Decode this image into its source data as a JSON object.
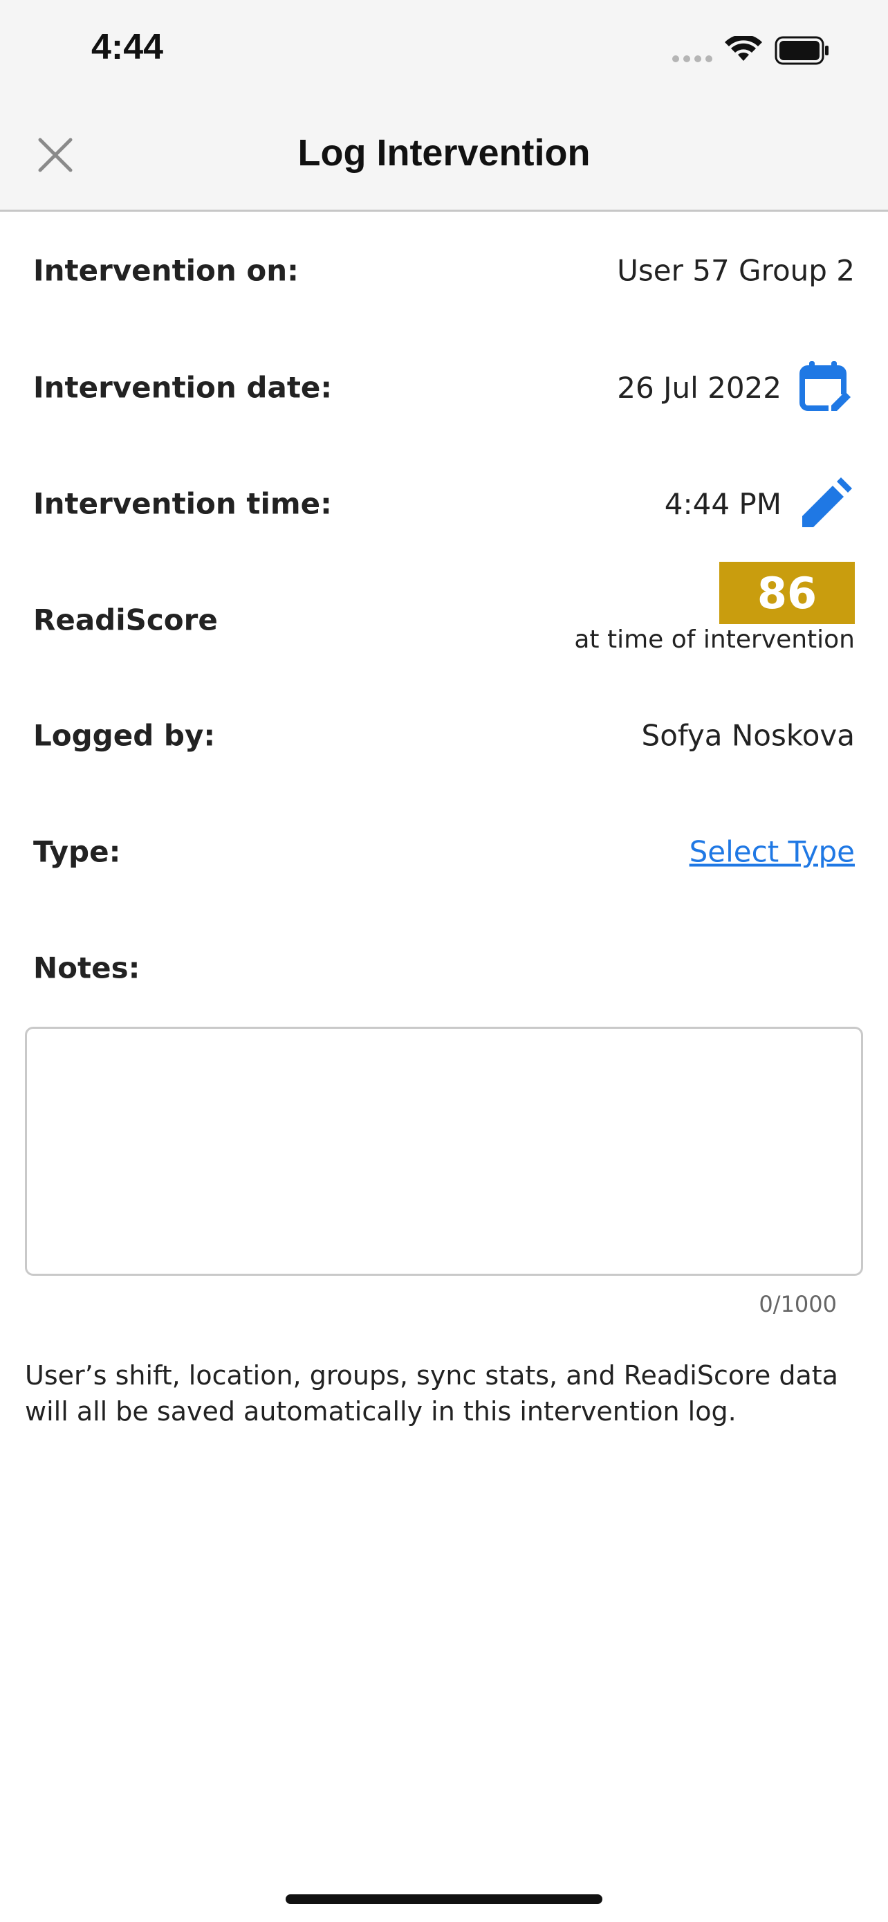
{
  "status_bar": {
    "time": "4:44"
  },
  "header": {
    "title": "Log Intervention"
  },
  "form": {
    "intervention_on": {
      "label": "Intervention on:",
      "value": "User 57 Group 2"
    },
    "intervention_date": {
      "label": "Intervention date:",
      "value": "26 Jul 2022"
    },
    "intervention_time": {
      "label": "Intervention time:",
      "value": "4:44 PM"
    },
    "readiscore": {
      "label": "ReadiScore",
      "score": "86",
      "caption": "at time of intervention",
      "color": "#c99d0e"
    },
    "logged_by": {
      "label": "Logged by:",
      "value": "Sofya Noskova"
    },
    "type": {
      "label": "Type:",
      "link": "Select Type"
    },
    "notes": {
      "label": "Notes:",
      "value": "",
      "counter": "0/1000"
    }
  },
  "footer_note": "User’s shift, location, groups, sync stats, and ReadiScore data will all be saved automatically in this intervention log.",
  "colors": {
    "accent": "#1f78e4",
    "score": "#c99d0e",
    "header_bg": "#f5f5f5"
  },
  "icons": {
    "close": "close-icon",
    "date_edit": "calendar-edit-icon",
    "time_edit": "pencil-icon"
  }
}
